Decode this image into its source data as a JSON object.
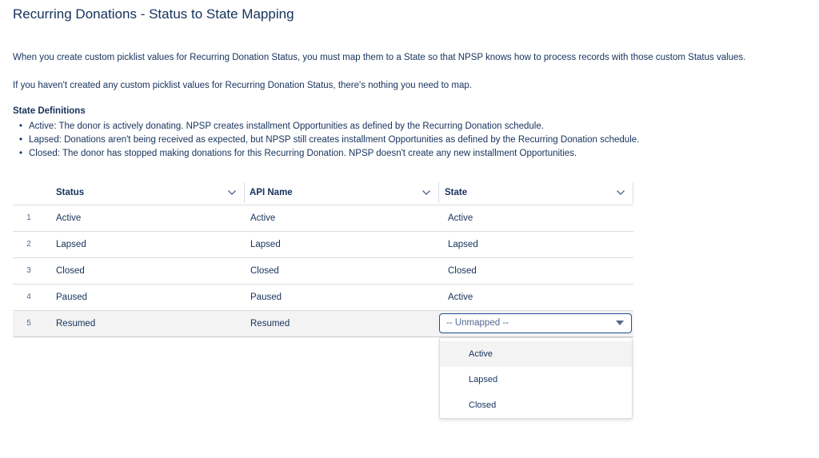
{
  "page": {
    "title": "Recurring Donations - Status to State Mapping",
    "intro_1": "When you create custom picklist values for Recurring Donation Status, you must map them to a State so that NPSP knows how to process records with those custom Status values.",
    "intro_2": "If you haven't created any custom picklist values for Recurring Donation Status, there's nothing you need to map.",
    "definitions_heading": "State Definitions",
    "definitions": [
      "Active: The donor is actively donating. NPSP creates installment Opportunities as defined by the Recurring Donation schedule.",
      "Lapsed: Donations aren't being received as expected, but NPSP still creates installment Opportunities as defined by the Recurring Donation schedule.",
      "Closed: The donor has stopped making donations for this Recurring Donation. NPSP doesn't create any new installment Opportunities."
    ]
  },
  "table": {
    "columns": [
      "Status",
      "API Name",
      "State"
    ],
    "rows": [
      {
        "num": "1",
        "status": "Active",
        "api_name": "Active",
        "state": "Active"
      },
      {
        "num": "2",
        "status": "Lapsed",
        "api_name": "Lapsed",
        "state": "Lapsed"
      },
      {
        "num": "3",
        "status": "Closed",
        "api_name": "Closed",
        "state": "Closed"
      },
      {
        "num": "4",
        "status": "Paused",
        "api_name": "Paused",
        "state": "Active"
      },
      {
        "num": "5",
        "status": "Resumed",
        "api_name": "Resumed",
        "state_select": "-- Unmapped --"
      }
    ]
  },
  "dropdown": {
    "options": [
      "Active",
      "Lapsed",
      "Closed"
    ],
    "highlighted": "Active"
  },
  "colors": {
    "text": "#16325c",
    "border": "#d8dde6",
    "focus_border": "#1b5297",
    "selected_row": "#f3f3f3"
  },
  "icons": {
    "header_sort": "chevron-down-icon",
    "select_caret": "caret-down-icon"
  }
}
